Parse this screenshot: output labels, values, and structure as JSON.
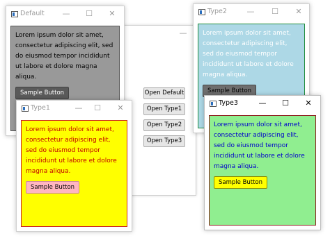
{
  "main_window": {
    "buttons": [
      "Open Default",
      "Open Type1",
      "Open Type2",
      "Open Type3"
    ]
  },
  "caption_buttons": {
    "minimize": "—",
    "maximize": "☐",
    "close": "✕"
  },
  "lorem": "Lorem ipsum dolor sit amet, consectetur adipiscing elit, sed do eiusmod tempor incididunt ut labore et dolore magna aliqua.",
  "windows": {
    "default": {
      "title": "Default",
      "button": "Sample Button"
    },
    "type1": {
      "title": "Type1",
      "button": "Sample Button"
    },
    "type2": {
      "title": "Type2",
      "button": "Sample Button"
    },
    "type3": {
      "title": "Type3",
      "button": "Sample Button"
    }
  },
  "colors": {
    "default_bg": "#999999",
    "type1_bg": "#ffff00",
    "type1_border": "#cc2222",
    "type2_bg": "#add8e6",
    "type2_border": "#1e8c3c",
    "type3_bg": "#90ee90",
    "type3_border": "#8b1a1a"
  }
}
